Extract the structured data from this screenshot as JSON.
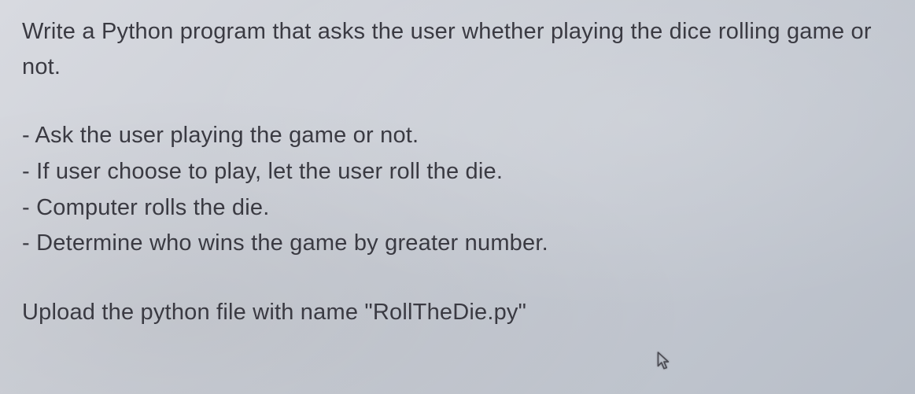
{
  "intro": "Write a Python program that asks the user whether playing the dice rolling game or not.",
  "bullets": [
    "- Ask the user playing the game or not.",
    "- If user choose to play, let the user roll the die.",
    "- Computer rolls the die.",
    "- Determine who wins the game by greater number."
  ],
  "upload": "Upload the python file with name \"RollTheDie.py\""
}
